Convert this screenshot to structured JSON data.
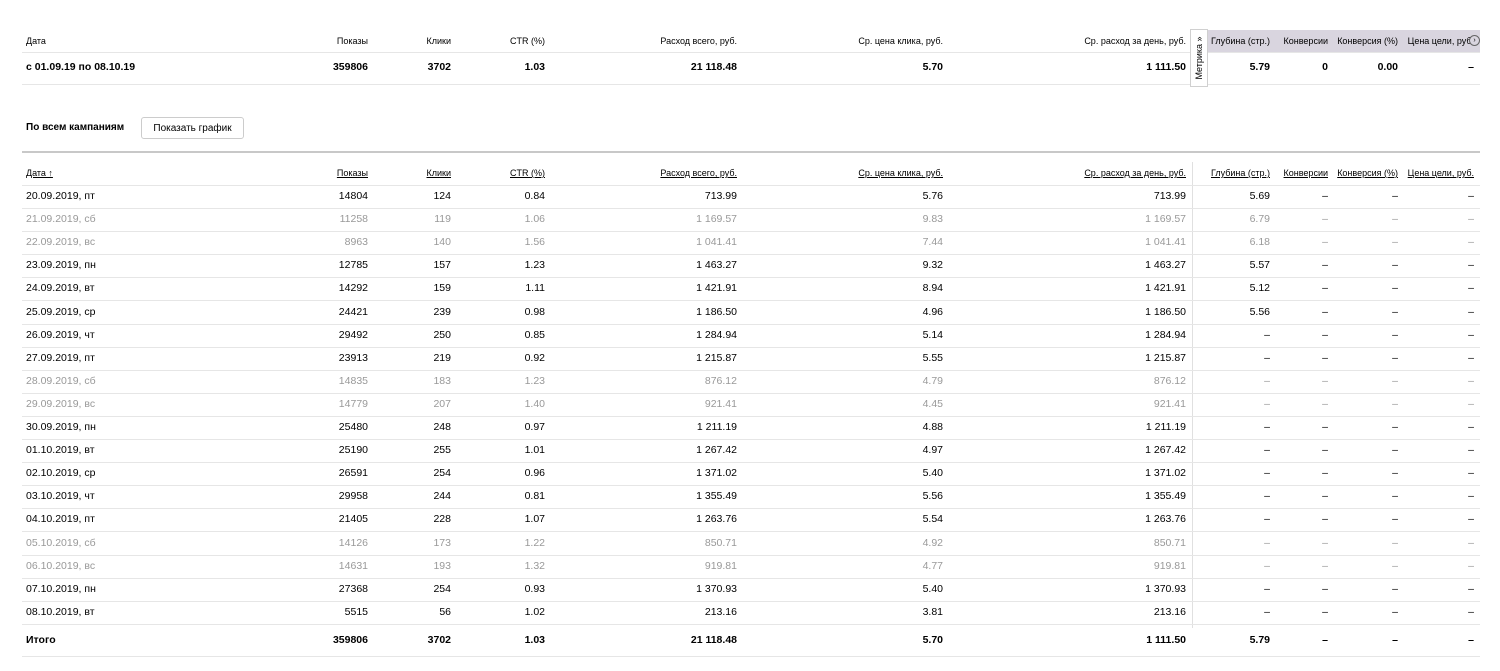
{
  "summary": {
    "headers": {
      "date": "Дата",
      "shows": "Показы",
      "clicks": "Клики",
      "ctr": "CTR (%)",
      "spend": "Расход всего, руб.",
      "cpc": "Ср. цена клика, руб.",
      "daily": "Ср. расход за день, руб.",
      "depth": "Глубина (стр.)",
      "conv": "Конверсии",
      "convpct": "Конверсия (%)",
      "goal": "Цена цели, руб."
    },
    "metrika_label": "Метрика »",
    "row": {
      "date": "с 01.09.19 по 08.10.19",
      "shows": "359806",
      "clicks": "3702",
      "ctr": "1.03",
      "spend": "21 118.48",
      "cpc": "5.70",
      "daily": "1 111.50",
      "depth": "5.79",
      "conv": "0",
      "convpct": "0.00",
      "goal": "–"
    }
  },
  "campaigns": {
    "label": "По всем кампаниям",
    "show_chart_button": "Показать график"
  },
  "table": {
    "headers": {
      "date": "Дата ↑",
      "shows": "Показы",
      "clicks": "Клики",
      "ctr": "CTR (%)",
      "spend": "Расход всего, руб.",
      "cpc": "Ср. цена клика, руб.",
      "daily": "Ср. расход за день, руб.",
      "depth": "Глубина (стр.)",
      "conv": "Конверсии",
      "convpct": "Конверсия (%)",
      "goal": "Цена цели, руб."
    },
    "rows": [
      {
        "date": "20.09.2019, пт",
        "shows": "14804",
        "clicks": "124",
        "ctr": "0.84",
        "spend": "713.99",
        "cpc": "5.76",
        "daily": "713.99",
        "depth": "5.69",
        "conv": "–",
        "convpct": "–",
        "goal": "–",
        "weekend": false
      },
      {
        "date": "21.09.2019, сб",
        "shows": "11258",
        "clicks": "119",
        "ctr": "1.06",
        "spend": "1 169.57",
        "cpc": "9.83",
        "daily": "1 169.57",
        "depth": "6.79",
        "conv": "–",
        "convpct": "–",
        "goal": "–",
        "weekend": true
      },
      {
        "date": "22.09.2019, вс",
        "shows": "8963",
        "clicks": "140",
        "ctr": "1.56",
        "spend": "1 041.41",
        "cpc": "7.44",
        "daily": "1 041.41",
        "depth": "6.18",
        "conv": "–",
        "convpct": "–",
        "goal": "–",
        "weekend": true
      },
      {
        "date": "23.09.2019, пн",
        "shows": "12785",
        "clicks": "157",
        "ctr": "1.23",
        "spend": "1 463.27",
        "cpc": "9.32",
        "daily": "1 463.27",
        "depth": "5.57",
        "conv": "–",
        "convpct": "–",
        "goal": "–",
        "weekend": false
      },
      {
        "date": "24.09.2019, вт",
        "shows": "14292",
        "clicks": "159",
        "ctr": "1.11",
        "spend": "1 421.91",
        "cpc": "8.94",
        "daily": "1 421.91",
        "depth": "5.12",
        "conv": "–",
        "convpct": "–",
        "goal": "–",
        "weekend": false
      },
      {
        "date": "25.09.2019, ср",
        "shows": "24421",
        "clicks": "239",
        "ctr": "0.98",
        "spend": "1 186.50",
        "cpc": "4.96",
        "daily": "1 186.50",
        "depth": "5.56",
        "conv": "–",
        "convpct": "–",
        "goal": "–",
        "weekend": false
      },
      {
        "date": "26.09.2019, чт",
        "shows": "29492",
        "clicks": "250",
        "ctr": "0.85",
        "spend": "1 284.94",
        "cpc": "5.14",
        "daily": "1 284.94",
        "depth": "–",
        "conv": "–",
        "convpct": "–",
        "goal": "–",
        "weekend": false
      },
      {
        "date": "27.09.2019, пт",
        "shows": "23913",
        "clicks": "219",
        "ctr": "0.92",
        "spend": "1 215.87",
        "cpc": "5.55",
        "daily": "1 215.87",
        "depth": "–",
        "conv": "–",
        "convpct": "–",
        "goal": "–",
        "weekend": false
      },
      {
        "date": "28.09.2019, сб",
        "shows": "14835",
        "clicks": "183",
        "ctr": "1.23",
        "spend": "876.12",
        "cpc": "4.79",
        "daily": "876.12",
        "depth": "–",
        "conv": "–",
        "convpct": "–",
        "goal": "–",
        "weekend": true
      },
      {
        "date": "29.09.2019, вс",
        "shows": "14779",
        "clicks": "207",
        "ctr": "1.40",
        "spend": "921.41",
        "cpc": "4.45",
        "daily": "921.41",
        "depth": "–",
        "conv": "–",
        "convpct": "–",
        "goal": "–",
        "weekend": true
      },
      {
        "date": "30.09.2019, пн",
        "shows": "25480",
        "clicks": "248",
        "ctr": "0.97",
        "spend": "1 211.19",
        "cpc": "4.88",
        "daily": "1 211.19",
        "depth": "–",
        "conv": "–",
        "convpct": "–",
        "goal": "–",
        "weekend": false
      },
      {
        "date": "01.10.2019, вт",
        "shows": "25190",
        "clicks": "255",
        "ctr": "1.01",
        "spend": "1 267.42",
        "cpc": "4.97",
        "daily": "1 267.42",
        "depth": "–",
        "conv": "–",
        "convpct": "–",
        "goal": "–",
        "weekend": false
      },
      {
        "date": "02.10.2019, ср",
        "shows": "26591",
        "clicks": "254",
        "ctr": "0.96",
        "spend": "1 371.02",
        "cpc": "5.40",
        "daily": "1 371.02",
        "depth": "–",
        "conv": "–",
        "convpct": "–",
        "goal": "–",
        "weekend": false
      },
      {
        "date": "03.10.2019, чт",
        "shows": "29958",
        "clicks": "244",
        "ctr": "0.81",
        "spend": "1 355.49",
        "cpc": "5.56",
        "daily": "1 355.49",
        "depth": "–",
        "conv": "–",
        "convpct": "–",
        "goal": "–",
        "weekend": false
      },
      {
        "date": "04.10.2019, пт",
        "shows": "21405",
        "clicks": "228",
        "ctr": "1.07",
        "spend": "1 263.76",
        "cpc": "5.54",
        "daily": "1 263.76",
        "depth": "–",
        "conv": "–",
        "convpct": "–",
        "goal": "–",
        "weekend": false
      },
      {
        "date": "05.10.2019, сб",
        "shows": "14126",
        "clicks": "173",
        "ctr": "1.22",
        "spend": "850.71",
        "cpc": "4.92",
        "daily": "850.71",
        "depth": "–",
        "conv": "–",
        "convpct": "–",
        "goal": "–",
        "weekend": true
      },
      {
        "date": "06.10.2019, вс",
        "shows": "14631",
        "clicks": "193",
        "ctr": "1.32",
        "spend": "919.81",
        "cpc": "4.77",
        "daily": "919.81",
        "depth": "–",
        "conv": "–",
        "convpct": "–",
        "goal": "–",
        "weekend": true
      },
      {
        "date": "07.10.2019, пн",
        "shows": "27368",
        "clicks": "254",
        "ctr": "0.93",
        "spend": "1 370.93",
        "cpc": "5.40",
        "daily": "1 370.93",
        "depth": "–",
        "conv": "–",
        "convpct": "–",
        "goal": "–",
        "weekend": false
      },
      {
        "date": "08.10.2019, вт",
        "shows": "5515",
        "clicks": "56",
        "ctr": "1.02",
        "spend": "213.16",
        "cpc": "3.81",
        "daily": "213.16",
        "depth": "–",
        "conv": "–",
        "convpct": "–",
        "goal": "–",
        "weekend": false
      }
    ],
    "total": {
      "date": "Итого",
      "shows": "359806",
      "clicks": "3702",
      "ctr": "1.03",
      "spend": "21 118.48",
      "cpc": "5.70",
      "daily": "1 111.50",
      "depth": "5.79",
      "conv": "–",
      "convpct": "–",
      "goal": "–"
    }
  }
}
